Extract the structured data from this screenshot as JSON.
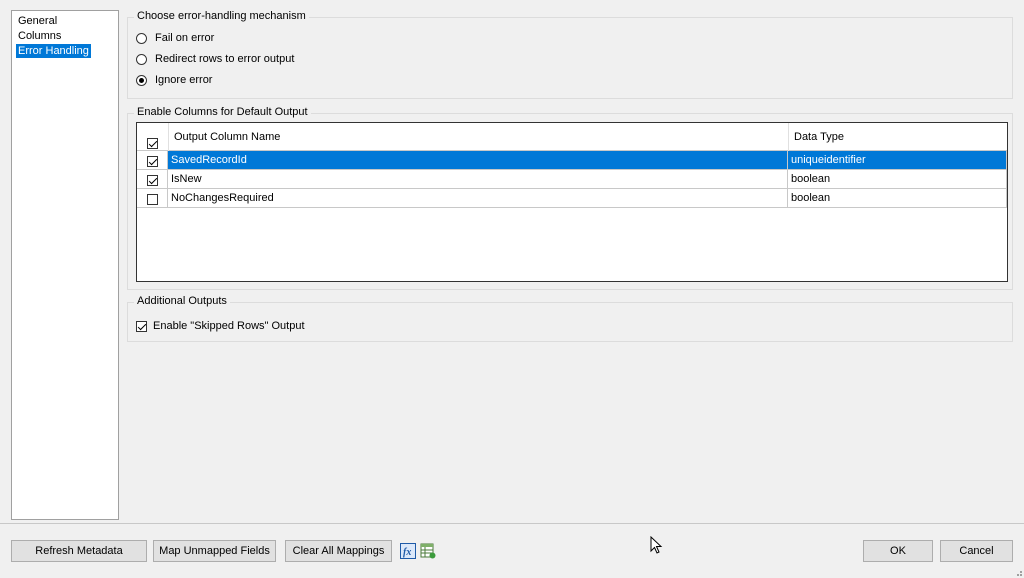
{
  "nav": {
    "items": [
      {
        "label": "General",
        "selected": false
      },
      {
        "label": "Columns",
        "selected": false
      },
      {
        "label": "Error Handling",
        "selected": true
      }
    ]
  },
  "error_mechanism": {
    "title": "Choose error-handling mechanism",
    "options": [
      {
        "label": "Fail on error",
        "selected": false
      },
      {
        "label": "Redirect rows to error output",
        "selected": false
      },
      {
        "label": "Ignore error",
        "selected": true
      }
    ]
  },
  "default_output": {
    "title": "Enable Columns for Default Output",
    "headers": {
      "name": "Output Column Name",
      "type": "Data Type"
    },
    "header_checked": true,
    "rows": [
      {
        "checked": true,
        "name": "SavedRecordId",
        "type": "uniqueidentifier",
        "selected": true
      },
      {
        "checked": true,
        "name": "IsNew",
        "type": "boolean",
        "selected": false
      },
      {
        "checked": false,
        "name": "NoChangesRequired",
        "type": "boolean",
        "selected": false
      }
    ]
  },
  "additional_outputs": {
    "title": "Additional Outputs",
    "skipped_rows_label": "Enable \"Skipped Rows\" Output",
    "skipped_rows_checked": true
  },
  "buttons": {
    "refresh": "Refresh Metadata",
    "map_unmapped": "Map Unmapped Fields",
    "clear_mappings": "Clear All Mappings",
    "ok": "OK",
    "cancel": "Cancel"
  },
  "icons": {
    "expression": "fx-icon",
    "mapping": "grid-mapping-icon"
  },
  "colors": {
    "selection": "#0078d7"
  }
}
